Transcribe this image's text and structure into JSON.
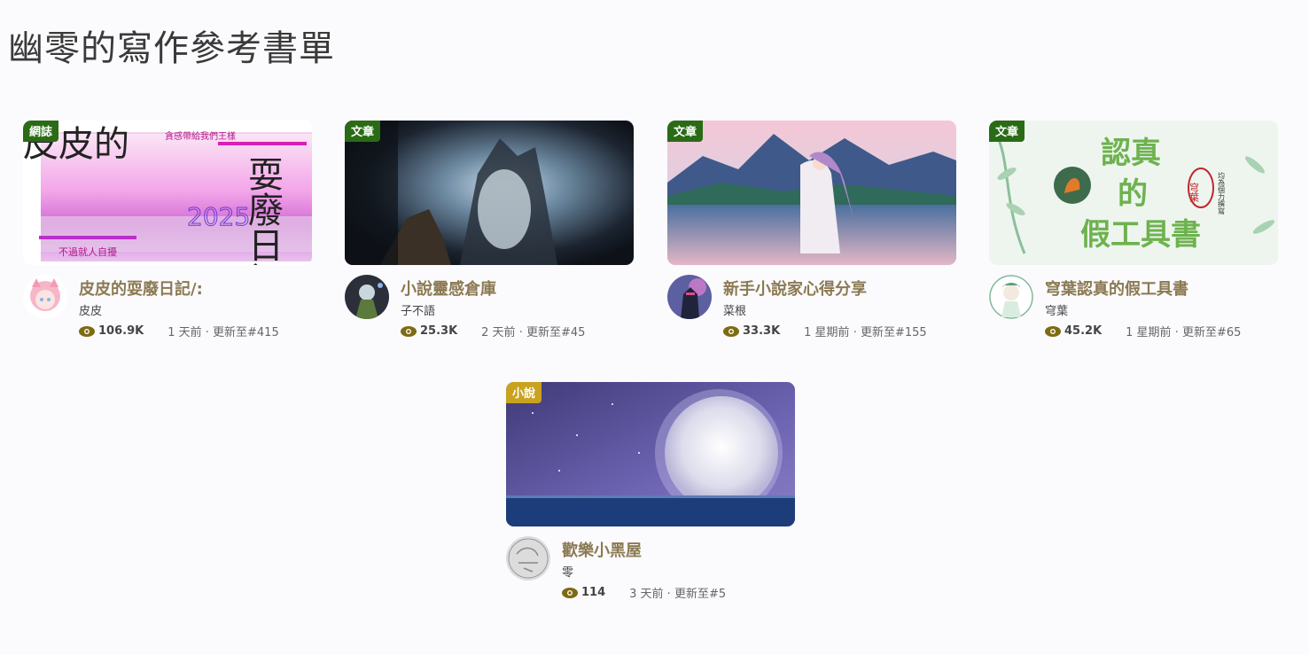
{
  "page": {
    "title": "幽零的寫作參考書單"
  },
  "colors": {
    "badge_green": "#2a6b15",
    "badge_gold": "#c9a21f",
    "title_brown": "#8b7a52",
    "eye_olive": "#7d6b12"
  },
  "cards": [
    {
      "badge": "網誌",
      "title": "皮皮的耍廢日記/:",
      "author": "皮皮",
      "views": "106.9K",
      "updated": "1 天前 · 更新至#415",
      "cover_text": {
        "left": "皮皮的",
        "right": "耍廢日記",
        "top": "貪感帶給我們王樣",
        "bottom": "不過就人自擾",
        "year": "2025"
      }
    },
    {
      "badge": "文章",
      "title": "小說靈感倉庫",
      "author": "子不語",
      "views": "25.3K",
      "updated": "2 天前 · 更新至#45"
    },
    {
      "badge": "文章",
      "title": "新手小說家心得分享",
      "author": "菜根",
      "views": "33.3K",
      "updated": "1 星期前 · 更新至#155"
    },
    {
      "badge": "文章",
      "title": "穹葉認真的假工具書",
      "author": "穹葉",
      "views": "45.2K",
      "updated": "1 星期前 · 更新至#65",
      "cover_text": {
        "line1": "認真",
        "line2": "的",
        "line3": "假工具書",
        "seal": "穹葉",
        "side": "均為個力撰寫"
      }
    },
    {
      "badge": "小說",
      "title": "歡樂小黑屋",
      "author": "零",
      "views": "114",
      "updated": "3 天前 · 更新至#5"
    }
  ]
}
